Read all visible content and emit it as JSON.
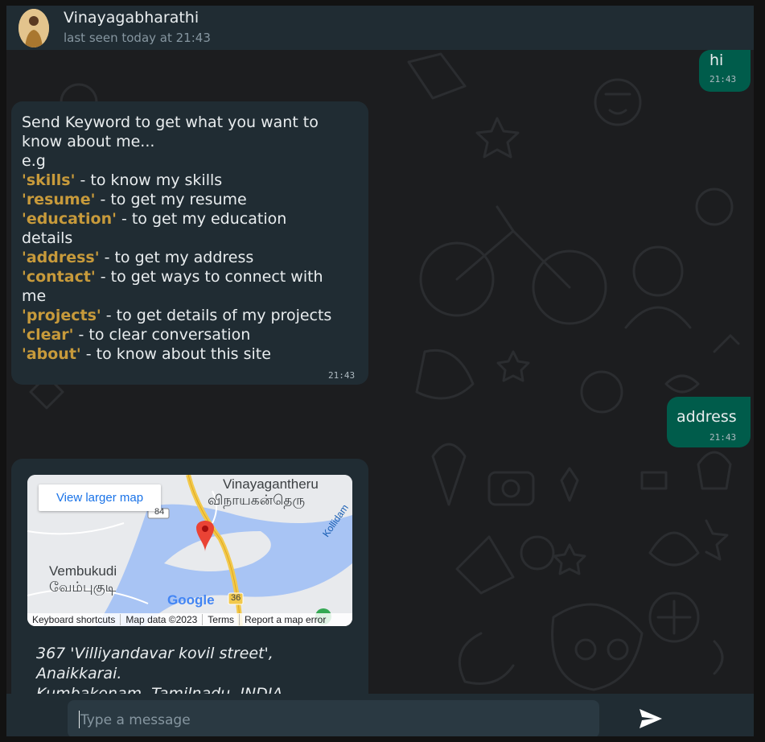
{
  "header": {
    "contact_name": "Vinayagabharathi",
    "status": "last seen today at 21:43"
  },
  "messages": [
    {
      "direction": "outgoing",
      "text": "hi",
      "time": "21:43"
    },
    {
      "direction": "incoming",
      "time": "21:43",
      "intro": [
        "Send Keyword to get what you want to",
        "know about me...",
        "e.g"
      ],
      "keywords": [
        {
          "keyword": "'skills'",
          "desc": " - to know my skills"
        },
        {
          "keyword": "'resume'",
          "desc": " - to get my resume"
        },
        {
          "keyword": "'education'",
          "desc": " - to get my education"
        },
        {
          "keyword": "",
          "desc": "details"
        },
        {
          "keyword": "'address'",
          "desc": " - to get my address"
        },
        {
          "keyword": "'contact'",
          "desc": " - to get ways to connect with"
        },
        {
          "keyword": "",
          "desc": "me"
        },
        {
          "keyword": "'projects'",
          "desc": " - to get details of my projects"
        },
        {
          "keyword": "'clear'",
          "desc": " - to clear conversation"
        },
        {
          "keyword": "'about'",
          "desc": " - to know about this site"
        }
      ]
    },
    {
      "direction": "outgoing",
      "text": "address",
      "time": "21:43"
    },
    {
      "direction": "incoming",
      "map": {
        "view_larger": "View larger map",
        "labels": {
          "vinayagantheru_en": "Vinayagantheru",
          "vinayagantheru_ta": "விநாயகன்தெரு",
          "vembukudi_en": "Vembukudi",
          "vembukudi_ta": "வேம்புகுடி",
          "kollidam": "Kollidam",
          "road_84": "84",
          "road_36": "36",
          "google": "Google"
        },
        "footer": [
          "Keyboard shortcuts",
          "Map data ©2023",
          "Terms",
          "Report a map error"
        ]
      },
      "address_lines": [
        "367 'Villiyandavar kovil street',",
        "Anaikkarai.",
        "Kumbakonam, Tamilnadu, INDIA"
      ]
    }
  ],
  "composer": {
    "placeholder": "Type a message",
    "send_icon": "send-icon"
  },
  "colors": {
    "header_bg": "#202c33",
    "outgoing_bubble": "#005c4b",
    "incoming_bubble": "#202c33",
    "keyword": "#c79a3b"
  }
}
